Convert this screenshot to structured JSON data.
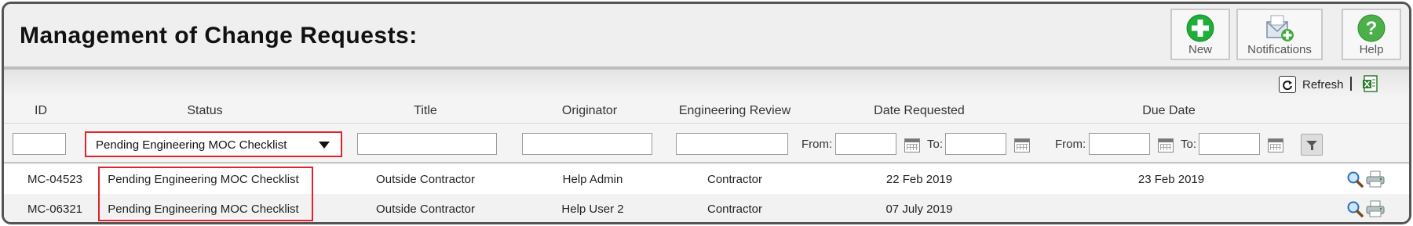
{
  "page": {
    "title": "Management of Change Requests:"
  },
  "toolbar_buttons": {
    "new_label": "New",
    "notifications_label": "Notifications",
    "help_label": "Help"
  },
  "grid_toolbar": {
    "refresh_label": "Refresh"
  },
  "columns": {
    "id": "ID",
    "status": "Status",
    "title": "Title",
    "originator": "Originator",
    "engineering_review": "Engineering Review",
    "date_requested": "Date Requested",
    "due_date": "Due Date"
  },
  "filters": {
    "id": "",
    "status_selected": "Pending Engineering MOC Checklist",
    "title": "",
    "originator": "",
    "engineering_review": "",
    "date_requested": {
      "from_label": "From:",
      "to_label": "To:",
      "from": "",
      "to": ""
    },
    "due_date": {
      "from_label": "From:",
      "to_label": "To:",
      "from": "",
      "to": ""
    }
  },
  "rows": [
    {
      "id": "MC-04523",
      "status": "Pending Engineering MOC Checklist",
      "title": "Outside Contractor",
      "originator": "Help Admin",
      "engineering_review": "Contractor",
      "date_requested": "22 Feb 2019",
      "due_date": "23 Feb 2019"
    },
    {
      "id": "MC-06321",
      "status": "Pending Engineering MOC Checklist",
      "title": "Outside Contractor",
      "originator": "Help User 2",
      "engineering_review": "Contractor",
      "date_requested": "07 July 2019",
      "due_date": ""
    }
  ],
  "colors": {
    "highlight": "#e0222a",
    "new_icon": "#1fae3a",
    "help_icon": "#4bb04a",
    "excel_icon": "#2f7d32"
  },
  "icons": {
    "new": "plus-circle-icon",
    "notifications": "envelope-plus-icon",
    "help": "question-circle-icon",
    "refresh": "refresh-icon",
    "export": "excel-export-icon",
    "view": "magnifier-icon",
    "print": "printer-icon",
    "calendar": "calendar-icon",
    "filter": "funnel-icon"
  }
}
